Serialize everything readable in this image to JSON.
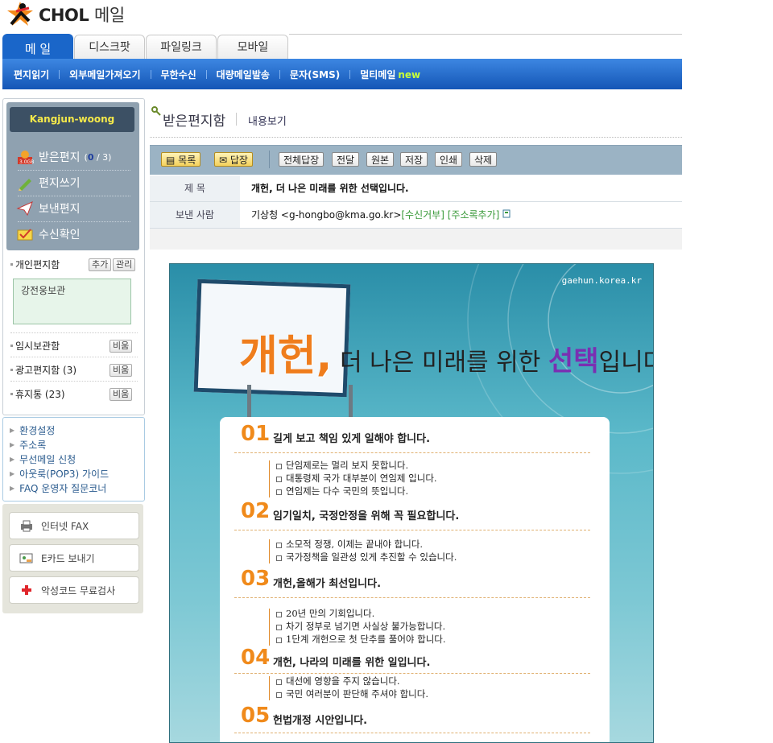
{
  "app": {
    "logo_brand": "CHOL",
    "logo_suffix": "메일"
  },
  "tabs": [
    "메 일",
    "디스크팟",
    "파일링크",
    "모바일"
  ],
  "subnav": {
    "items": [
      "편지읽기",
      "외부메일가져오기",
      "무한수신",
      "대량메일발송",
      "문자(SMS)",
      "멀티메일"
    ],
    "new_badge": "new"
  },
  "sidebar": {
    "user": "Kangjun-woong",
    "folders": {
      "inbox": {
        "label": "받은편지",
        "unread": "0",
        "total": "/ 3)",
        "open": "("
      },
      "compose": "편지쓰기",
      "sent": "보낸편지",
      "receipt": "수신확인"
    },
    "personal": {
      "label": "개인편지함",
      "add": "추가",
      "manage": "관리",
      "folder_item": "강전웅보관"
    },
    "others": [
      {
        "label": "임시보관함",
        "btn": "비움"
      },
      {
        "label": "광고편지함 (3)",
        "btn": "비움"
      },
      {
        "label": "휴지통 (23)",
        "btn": "비움"
      }
    ],
    "links": [
      "환경설정",
      "주소록",
      "무선메일 신청",
      "아웃룩(POP3) 가이드",
      "FAQ 운영자 질문코너"
    ],
    "services": [
      "인터넷 FAX",
      "E카드 보내기",
      "악성코드 무료검사"
    ]
  },
  "main": {
    "title": "받은편지함",
    "subtitle": "내용보기",
    "toolbar": [
      "목록",
      "답장",
      "전체답장",
      "전달",
      "원본",
      "저장",
      "인쇄",
      "삭제"
    ],
    "header": {
      "subject_label": "제 목",
      "subject": "개헌, 더 나은 미래를 위한 선택입니다.",
      "from_label": "보낸 사람",
      "from": "기상청 <g-hongbo@kma.go.kr>",
      "reject": "[수신거부]",
      "add_addr": "[주소록추가]"
    },
    "banner": {
      "url": "gaehun.korea.kr",
      "headline_big": "개헌,",
      "headline_mid": " 더 나은 미래를 위한 ",
      "headline_pur": "선택",
      "headline_end": "입니다.",
      "sections": [
        {
          "num": "01",
          "title": "길게 보고 책임 있게 일해야 합니다.",
          "bullets": [
            "단임제로는 멀리 보지 못합니다.",
            "대통령제 국가 대부분이 연임제 입니다.",
            "연임제는 다수 국민의 뜻입니다."
          ]
        },
        {
          "num": "02",
          "title": "임기일치, 국정안정을 위해 꼭 필요합니다.",
          "bullets": [
            "소모적 정쟁, 이제는 끝내야 합니다.",
            "국가정책을 일관성 있게 추진할 수 있습니다."
          ]
        },
        {
          "num": "03",
          "title": "개헌,올해가 최선입니다.",
          "bullets": [
            "20년 만의 기회입니다.",
            "차기 정부로 넘기면 사실상 불가능합니다.",
            "1단계 개헌으로 첫 단추를 풀어야 합니다."
          ]
        },
        {
          "num": "04",
          "title": "개헌, 나라의 미래를 위한 일입니다.",
          "bullets": [
            "대선에 영향을 주지 않습니다.",
            "국민 여러분이 판단해 주셔야 합니다."
          ]
        },
        {
          "num": "05",
          "title": "헌법개정 시안입니다.",
          "bullets": []
        }
      ]
    }
  },
  "colors": {
    "nav_blue": "#1a66c9",
    "sidebar_slate": "#8fa1b0",
    "toolbar": "#9bb3c4",
    "accent_orange": "#f08a1b",
    "accent_purple": "#7a2fb2"
  }
}
